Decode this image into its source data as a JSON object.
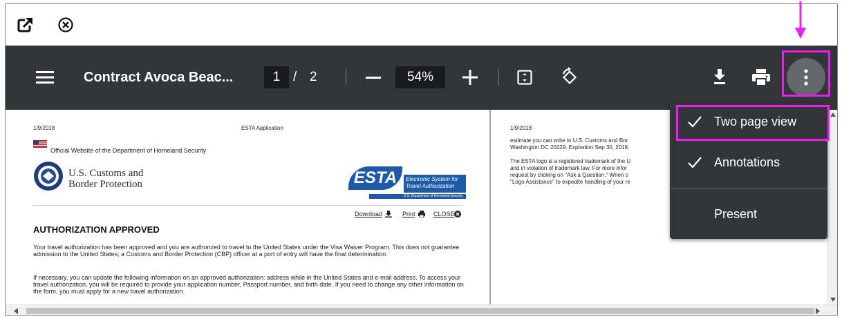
{
  "viewer": {
    "title": "Contract Avoca Beac...",
    "current_page": "1",
    "page_separator": "/",
    "total_pages": "2",
    "zoom": "54%"
  },
  "menu": {
    "items": [
      {
        "label": "Two page view",
        "checked": true
      },
      {
        "label": "Annotations",
        "checked": true
      },
      {
        "label": "Present",
        "checked": false
      }
    ]
  },
  "page1": {
    "date": "1/9/2018",
    "header_center": "ESTA Application",
    "gov_banner": "Official Website of the Department of Homeland Security",
    "cbp_line1": "U.S. Customs and",
    "cbp_line2": "Border Protection",
    "esta_logo": "ESTA",
    "esta_sub1": "Electronic System for",
    "esta_sub2": "Travel Authorization",
    "esta_dept": "U.S. Department of Homeland Security",
    "link_download": "Download",
    "link_print": "Print",
    "link_close": "CLOSE",
    "heading": "AUTHORIZATION APPROVED",
    "para1": "Your travel authorization has been approved and you are authorized to travel to the United States under the Visa Waiver Program. This does not guarantee admission to the United States; a Customs and Border Protection (CBP) officer at a port of entry will have the final determination.",
    "para2": "If necessary, you can update the following information on an approved authorization: address while in the United States and e-mail address. To access your travel authorization, you will be required to provide your application number, Passport number, and birth date. If you need to change any other information on the form, you must apply for a new travel authorization."
  },
  "page2": {
    "date": "1/9/2018",
    "para1_l1": "estimate you can write to U.S. Customs and Bor",
    "para1_l2": "Washington DC 20229. Expiration Sep 30, 2018.",
    "para2_l1": "The ESTA logo is a registered trademark of the U",
    "para2_l2": "and in violation of trademark law. For more infor",
    "para2_l3": "request by clicking on \"Ask a Question.\" When s",
    "para2_l4": "\"Logo Assistance\" to expedite handling of your re"
  },
  "colors": {
    "toolbar_bg": "#323639",
    "menu_bg": "#323639",
    "highlight": "#ee1fee",
    "menu_button_bg": "#65686b"
  },
  "icons": {
    "open_external": "open-in-new-icon",
    "close": "close-circle-icon",
    "hamburger": "menu-icon",
    "zoom_out": "minus-icon",
    "zoom_in": "plus-icon",
    "fit": "fit-page-icon",
    "rotate": "rotate-icon",
    "download": "download-icon",
    "print": "print-icon",
    "more": "more-vert-icon",
    "check": "check-icon"
  }
}
